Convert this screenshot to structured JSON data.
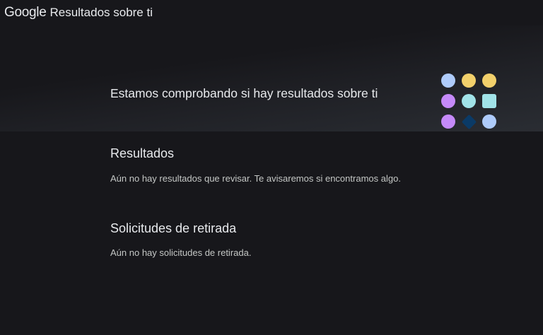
{
  "header": {
    "logo_text": "Google",
    "product_name": "Resultados sobre ti"
  },
  "hero": {
    "title": "Estamos comprobando si hay resultados sobre ti",
    "illustration": {
      "name": "dot-grid-illustration",
      "colors": {
        "blue": "#aecbfa",
        "yellow": "#f2d06b",
        "purple": "#c58af9",
        "teal": "#a1e3e8",
        "navy": "#0b3a66"
      }
    }
  },
  "results": {
    "title": "Resultados",
    "message": "Aún no hay resultados que revisar. Te avisaremos si encontramos algo."
  },
  "removals": {
    "title": "Solicitudes de retirada",
    "message": "Aún no hay solicitudes de retirada."
  },
  "theme": {
    "background": "#17171b",
    "text": "#e8eaed",
    "muted_text": "#c4c7c5"
  }
}
